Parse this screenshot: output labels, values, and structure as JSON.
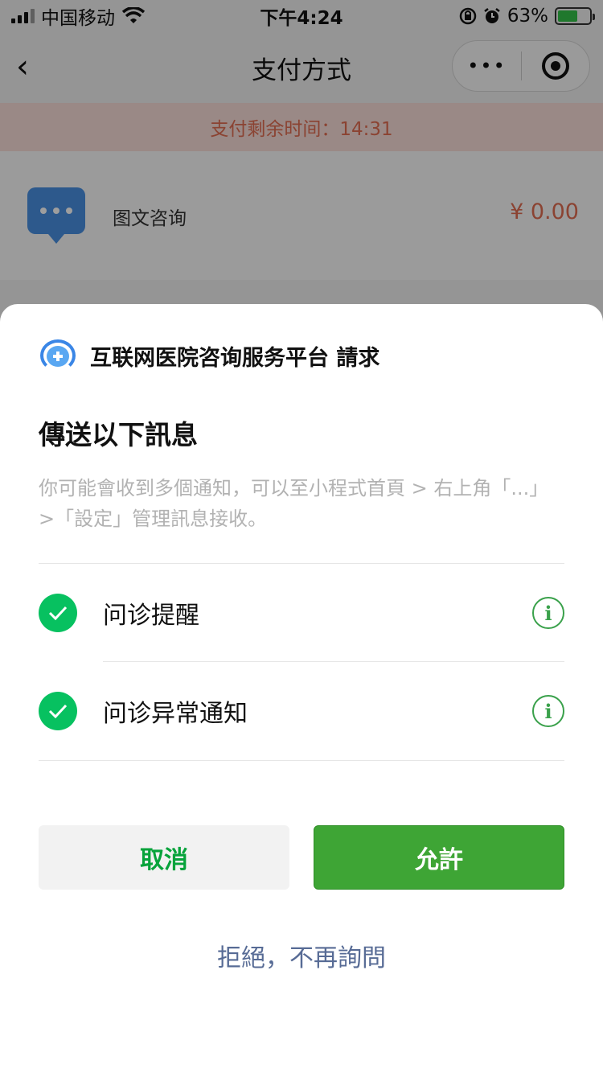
{
  "status_bar": {
    "carrier": "中国移动",
    "time": "下午4:24",
    "battery_percent": "63%",
    "battery_level": 0.63,
    "icons": [
      "signal-icon",
      "wifi-icon",
      "orientation-lock-icon",
      "alarm-icon",
      "battery-icon"
    ]
  },
  "nav": {
    "back_icon": "‹",
    "title": "支付方式",
    "more_icon": "•••"
  },
  "countdown": {
    "text": "支付剩余时间：14:31"
  },
  "order": {
    "item_name": "图文咨询",
    "price": "¥ 0.00",
    "icon": "chat-bubble-icon"
  },
  "sheet": {
    "app_name": "互联网医院咨询服务平台 請求",
    "title": "傳送以下訊息",
    "description": "你可能會收到多個通知，可以至小程式首頁 > 右上角「...」>「設定」管理訊息接收。",
    "permissions": [
      {
        "label": "问诊提醒",
        "checked": true
      },
      {
        "label": "问诊异常通知",
        "checked": true
      }
    ],
    "info_icon_text": "i",
    "cancel_label": "取消",
    "allow_label": "允許",
    "reject_label": "拒絕，不再詢問"
  },
  "colors": {
    "accent_green": "#07c160",
    "allow_button": "#3ea535",
    "countdown_bg": "#f8ded8",
    "countdown_text": "#e06c52",
    "price": "#e06c52",
    "link_blue": "#576b95"
  }
}
